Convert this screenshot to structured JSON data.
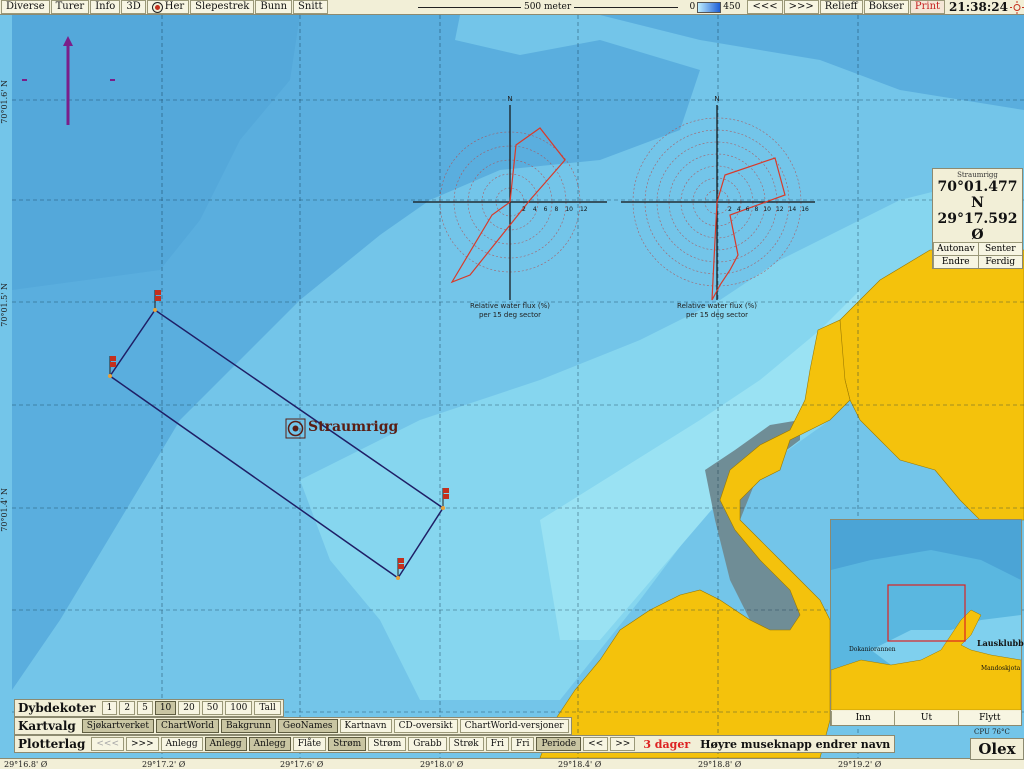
{
  "toolbar": {
    "left": [
      "Diverse",
      "Turer",
      "Info",
      "3D"
    ],
    "her": "Her",
    "right": [
      "Slepestrek",
      "Bunn",
      "Snitt"
    ],
    "scale": "500 meter",
    "depth_min": "0",
    "depth_max": "450",
    "nav_prev": "<<<",
    "nav_next": ">>>",
    "relief": "Relieff",
    "bokser": "Bokser",
    "print": "Print",
    "clock": "21:38:24"
  },
  "grid": {
    "lat_labels": [
      "70°01.6' N",
      "70°01.5' N",
      "70°01.4' N"
    ],
    "lon_labels": [
      "29°16.8' Ø",
      "29°17.2' Ø",
      "29°17.6' Ø",
      "29°18.0' Ø",
      "29°18.4' Ø",
      "29°18.8' Ø",
      "29°19.2' Ø"
    ]
  },
  "roses": [
    {
      "north": "N",
      "ticks": [
        "2",
        "4",
        "6",
        "8",
        "10",
        "12"
      ],
      "caption1": "Relative water flux (%)",
      "caption2": "per 15 deg sector"
    },
    {
      "north": "N",
      "ticks": [
        "2",
        "4",
        "6",
        "8",
        "10",
        "12",
        "14",
        "16"
      ],
      "caption1": "Relative water flux (%)",
      "caption2": "per 15 deg sector"
    }
  ],
  "rig": {
    "name": "Straumrigg"
  },
  "position_box": {
    "name": "Straumrigg",
    "lat": "70°01.477 N",
    "lon": "29°17.592 Ø",
    "buttons": [
      "Autonav",
      "Senter",
      "Endre",
      "Ferdig"
    ]
  },
  "overview": {
    "labels": [
      "Lausklubb",
      "Dokaniorannen",
      "Mandoskjota"
    ],
    "buttons": [
      "Inn",
      "Ut",
      "Flytt"
    ]
  },
  "dybdekoter": {
    "label": "Dybdekoter",
    "options": [
      "1",
      "2",
      "5",
      "10",
      "20",
      "50",
      "100",
      "Tall"
    ],
    "selected": "10"
  },
  "kartvalg": {
    "label": "Kartvalg",
    "options": [
      "Sjøkartverket",
      "ChartWorld",
      "Bakgrunn",
      "GeoNames",
      "Kartnavn",
      "CD-oversikt",
      "ChartWorld-versjoner"
    ]
  },
  "plotterlag": {
    "label": "Plotterlag",
    "nav_prev": "<<<",
    "nav_next": ">>>",
    "items": [
      "Anlegg",
      "Anlegg",
      "Anlegg",
      "Flåte",
      "Strøm",
      "Strøm",
      "Grabb",
      "Strøk",
      "Fri",
      "Fri",
      "Periode"
    ],
    "nav2_prev": "<<",
    "nav2_next": ">>",
    "warning": "3 dager",
    "hint": "Høyre museknapp endrer navn"
  },
  "status": {
    "cpu": "CPU 76°C",
    "logo": "Olex"
  },
  "colors": {
    "deep": "#5fb0df",
    "mid": "#72c6ea",
    "shallow": "#8fdcf0",
    "land": "#f4c20c",
    "intertidal": "#6f8d96",
    "line": "#1f1f66"
  }
}
